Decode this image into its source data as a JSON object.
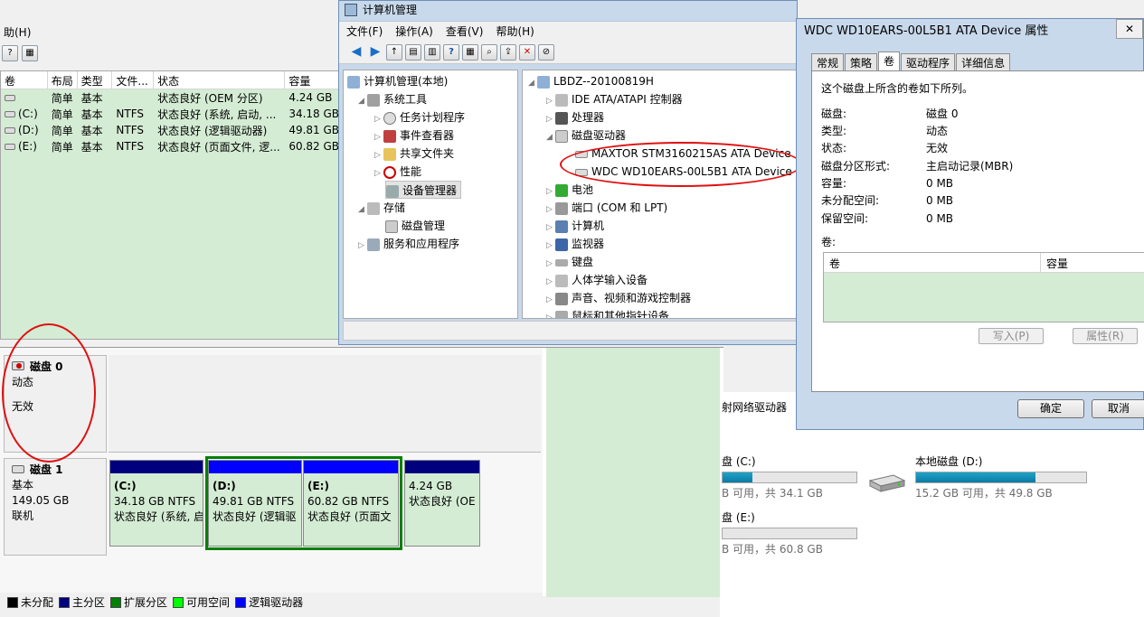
{
  "dm": {
    "menu": [
      "助(H)"
    ],
    "vol_headers": [
      "卷",
      "布局",
      "类型",
      "文件...",
      "状态",
      "容量"
    ],
    "volumes": [
      {
        "name": "",
        "layout": "简单",
        "type": "基本",
        "fs": "",
        "status": "状态良好 (OEM 分区)",
        "cap": "4.24 GB"
      },
      {
        "name": "(C:)",
        "layout": "简单",
        "type": "基本",
        "fs": "NTFS",
        "status": "状态良好 (系统, 启动, ...",
        "cap": "34.18 GB"
      },
      {
        "name": "(D:)",
        "layout": "简单",
        "type": "基本",
        "fs": "NTFS",
        "status": "状态良好 (逻辑驱动器)",
        "cap": "49.81 GB"
      },
      {
        "name": "(E:)",
        "layout": "简单",
        "type": "基本",
        "fs": "NTFS",
        "status": "状态良好 (页面文件, 逻...",
        "cap": "60.82 GB"
      }
    ],
    "disk0": {
      "title": "磁盘 0",
      "type": "动态",
      "state": "无效"
    },
    "disk1": {
      "title": "磁盘 1",
      "type": "基本",
      "size": "149.05 GB",
      "state": "联机"
    },
    "partitions": [
      {
        "name": "(C:)",
        "size": "34.18 GB NTFS",
        "status": "状态良好 (系统, 启"
      },
      {
        "name": "(D:)",
        "size": "49.81 GB NTFS",
        "status": "状态良好 (逻辑驱"
      },
      {
        "name": "(E:)",
        "size": "60.82 GB NTFS",
        "status": "状态良好 (页面文"
      },
      {
        "name": "",
        "size": "4.24 GB",
        "status": "状态良好 (OE"
      }
    ],
    "legend": [
      {
        "label": "未分配",
        "color": "#000000"
      },
      {
        "label": "主分区",
        "color": "#00007f"
      },
      {
        "label": "扩展分区",
        "color": "#008000"
      },
      {
        "label": "可用空间",
        "color": "#00ff00"
      },
      {
        "label": "逻辑驱动器",
        "color": "#0000ff"
      }
    ]
  },
  "explorer": {
    "network_label": "射网络驱动器",
    "drives": [
      {
        "label": "盘 (C:)",
        "sub": "B 可用，共 34.1 GB",
        "used": 0.33
      },
      {
        "label": "本地磁盘 (D:)",
        "sub": "15.2 GB 可用，共 49.8 GB",
        "used": 0.7
      },
      {
        "label": "盘 (E:)",
        "sub": "B 可用，共 60.8 GB",
        "used": 0.0
      }
    ]
  },
  "cm": {
    "title": "计算机管理",
    "menu": [
      "文件(F)",
      "操作(A)",
      "查看(V)",
      "帮助(H)"
    ],
    "left_tree": [
      "计算机管理(本地)",
      "系统工具",
      "任务计划程序",
      "事件查看器",
      "共享文件夹",
      "性能",
      "设备管理器",
      "存储",
      "磁盘管理",
      "服务和应用程序"
    ],
    "right_tree": [
      "LBDZ--20100819H",
      "IDE ATA/ATAPI 控制器",
      "处理器",
      "磁盘驱动器",
      "MAXTOR STM3160215AS ATA Device",
      "WDC WD10EARS-00L5B1 ATA Device",
      "电池",
      "端口 (COM 和 LPT)",
      "计算机",
      "监视器",
      "键盘",
      "人体学输入设备",
      "声音、视频和游戏控制器",
      "鼠标和其他指针设备"
    ]
  },
  "pd": {
    "title": "WDC WD10EARS-00L5B1 ATA Device 属性",
    "tabs": [
      "常规",
      "策略",
      "卷",
      "驱动程序",
      "详细信息"
    ],
    "intro": "这个磁盘上所含的卷如下所列。",
    "props": [
      {
        "k": "磁盘:",
        "v": "磁盘 0"
      },
      {
        "k": "类型:",
        "v": "动态"
      },
      {
        "k": "状态:",
        "v": "无效"
      },
      {
        "k": "磁盘分区形式:",
        "v": "主启动记录(MBR)"
      },
      {
        "k": "容量:",
        "v": "0 MB"
      },
      {
        "k": "未分配空间:",
        "v": "0 MB"
      },
      {
        "k": "保留空间:",
        "v": "0 MB"
      }
    ],
    "vol_label": "卷:",
    "vol_headers": [
      "卷",
      "容量"
    ],
    "write_btn": "写入(P)",
    "prop_btn": "属性(R)",
    "ok": "确定",
    "cancel": "取消"
  }
}
